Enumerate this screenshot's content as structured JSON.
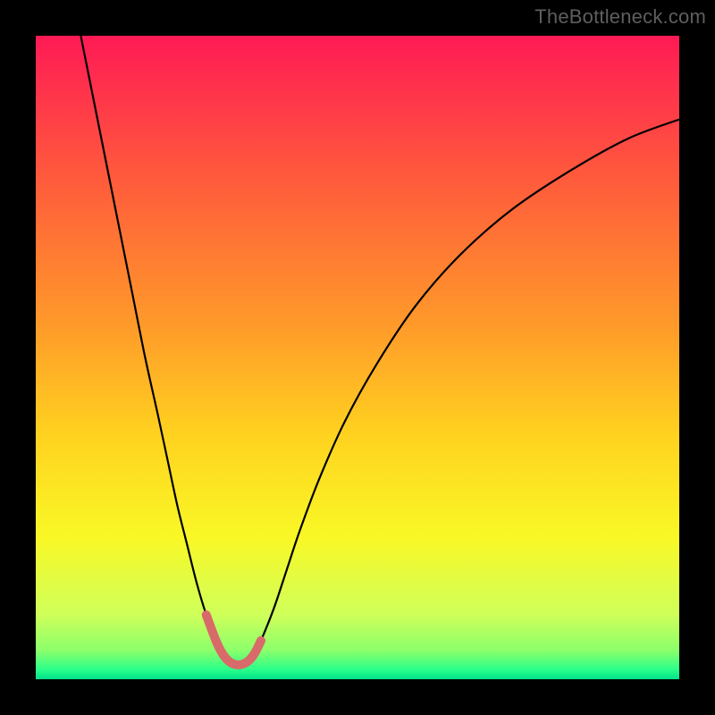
{
  "watermark": "TheBottleneck.com",
  "chart_data": {
    "type": "line",
    "title": "",
    "xlabel": "",
    "ylabel": "",
    "xlim": [
      0,
      100
    ],
    "ylim": [
      0,
      100
    ],
    "grid": false,
    "legend": false,
    "background_gradient_stops": [
      {
        "offset": 0,
        "color": "#ff1a55"
      },
      {
        "offset": 0.22,
        "color": "#ff5a3c"
      },
      {
        "offset": 0.45,
        "color": "#ff9a2a"
      },
      {
        "offset": 0.62,
        "color": "#ffd21f"
      },
      {
        "offset": 0.78,
        "color": "#f9f826"
      },
      {
        "offset": 0.9,
        "color": "#cfff5a"
      },
      {
        "offset": 0.955,
        "color": "#8cff6a"
      },
      {
        "offset": 0.985,
        "color": "#2aff8a"
      },
      {
        "offset": 1.0,
        "color": "#00e08a"
      }
    ],
    "series": [
      {
        "name": "bottleneck-curve",
        "stroke": "#000000",
        "stroke_width": 2.2,
        "x": [
          7,
          9,
          11,
          13,
          15,
          17,
          19,
          20.5,
          22,
          23.5,
          25,
          26.5,
          28,
          29,
          30,
          31,
          32,
          33,
          34,
          35,
          37,
          39,
          41,
          44,
          48,
          53,
          59,
          66,
          74,
          83,
          92,
          100
        ],
        "y": [
          100,
          90,
          80,
          70,
          60,
          50,
          41,
          34,
          27,
          21,
          15,
          10,
          6,
          4,
          2.8,
          2.3,
          2.3,
          2.8,
          4,
          6,
          11,
          17,
          23,
          31,
          40,
          49,
          58,
          66,
          73,
          79,
          84,
          87
        ]
      },
      {
        "name": "good-zone-highlight",
        "stroke": "#d86a6a",
        "stroke_width": 10,
        "linecap": "round",
        "x": [
          26.5,
          28,
          29,
          30,
          31,
          32,
          33,
          34,
          35
        ],
        "y": [
          10,
          6,
          4,
          2.8,
          2.3,
          2.3,
          2.8,
          4,
          6
        ]
      }
    ],
    "annotations": []
  }
}
